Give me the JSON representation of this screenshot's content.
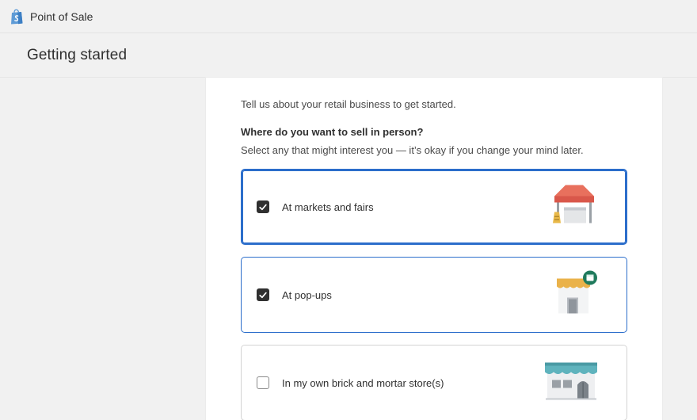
{
  "app": {
    "title": "Point of Sale",
    "logo_icon": "shopify-bag-icon"
  },
  "header": {
    "title": "Getting started"
  },
  "card": {
    "intro": "Tell us about your retail business to get started.",
    "question": "Where do you want to sell in person?",
    "hint": "Select any that might interest you — it’s okay if you change your mind later.",
    "options": [
      {
        "label": "At markets and fairs",
        "checked": true,
        "icon": "market-tent-icon"
      },
      {
        "label": "At pop-ups",
        "checked": true,
        "icon": "popup-shop-icon"
      },
      {
        "label": "In my own brick and mortar store(s)",
        "checked": false,
        "icon": "storefront-icon"
      }
    ]
  },
  "colors": {
    "accent": "#2c6ecb",
    "checkbox_checked": "#303030",
    "background": "#f1f1f1"
  }
}
